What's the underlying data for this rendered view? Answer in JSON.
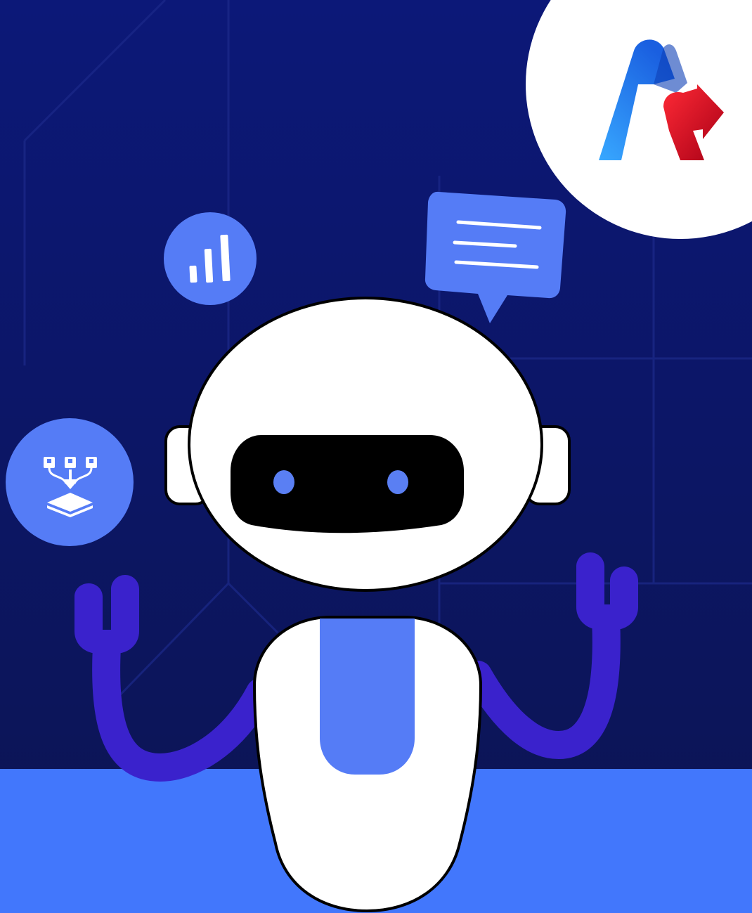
{
  "colors": {
    "background_top": "#0c1878",
    "background_bottom": "#0c1452",
    "floor": "#4277fc",
    "accent_blue": "#557cf6",
    "robot_arm": "#3a22cc",
    "robot_body": "#ffffff",
    "robot_visor": "#000000",
    "robot_eye": "#5a7ff3",
    "logo_blue": "#2d8ef0",
    "logo_red": "#d6091c"
  },
  "icons": {
    "logo": "brand-logo-icon",
    "chart": "bar-chart-icon",
    "chat": "chat-bubble-icon",
    "data_flow": "data-pipeline-icon",
    "robot": "robot-mascot"
  }
}
